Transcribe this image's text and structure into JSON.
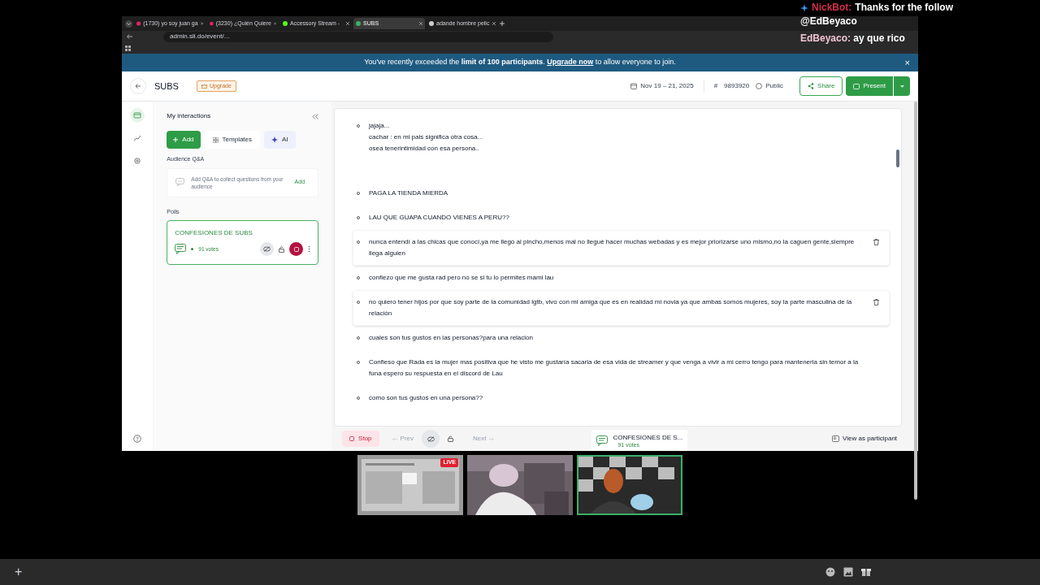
{
  "chat_overlay": {
    "lines": [
      {
        "kind": "partial",
        "user": "NickBot:",
        "text": "Thanks for the follow"
      },
      {
        "kind": "plain",
        "text": "@EdBeyaco"
      },
      {
        "kind": "message",
        "user": "EdBeyaco:",
        "text": " ay que rico"
      }
    ]
  },
  "browser": {
    "tabs": [
      {
        "label": "(1730) yo soy juan ga",
        "selected": false
      },
      {
        "label": "(3230) ¿Quién Quiere",
        "selected": false
      },
      {
        "label": "Accessory Stream -",
        "selected": false
      },
      {
        "label": "SUBS",
        "selected": true
      },
      {
        "label": "adande hombre pelic",
        "selected": false
      }
    ],
    "url": "admin.sli.do/event/..."
  },
  "banner": {
    "text": "You've recently exceeded the **limit of 100 participants**.",
    "link": "Upgrade now",
    "rest": " to allow everyone to join.",
    "close": "×"
  },
  "header": {
    "title": "SUBS",
    "upgrade": "Upgrade",
    "dates": "Nov 19 – 21, 2025",
    "code_symbol": "#",
    "code": "9893920",
    "privacy": "Public",
    "share": "Share",
    "present": "Present"
  },
  "rail": [
    {
      "selected": true
    },
    {
      "selected": false
    },
    {
      "selected": false
    }
  ],
  "panel": {
    "title": "My interactions",
    "buttons": [
      {
        "kind": "add",
        "label": "Add"
      },
      {
        "kind": "templates",
        "label": "Templates"
      },
      {
        "kind": "ai",
        "label": "AI"
      }
    ],
    "qa_heading": "Audience Q&A",
    "qa_text": "Add Q&A to collect questions from your audience",
    "qa_add": "Add",
    "polls_heading": "Polls",
    "poll": {
      "title": "CONFESIONES DE SUBS",
      "votes": "91 votes",
      "selected": true
    }
  },
  "responses": [
    {
      "lines": [
        "jajaja...",
        "cachar : en mi pais significa otra cosa...",
        "osea tenerintimidad con esa persona.."
      ],
      "hovered": false
    },
    {
      "lines": [
        "PAGA LA TIENDA MIERDA"
      ],
      "hovered": false
    },
    {
      "lines": [
        "LAU QUE GUAPA CUANDO VIENES A PERU??"
      ],
      "hovered": false
    },
    {
      "lines": [
        "nunca entendí a las chicas que conocí,ya me llegó al pincho,menos mal no llegué hacer muchas webadas y es mejor priorizarse uno mismo,no la caguen gente,siempre llega alguien"
      ],
      "hovered": true
    },
    {
      "lines": [
        "confiezo que me gusta rad pero no se si tu lo permites mami lau"
      ],
      "hovered": false
    },
    {
      "lines": [
        "no quiero tener hijos por que soy parte de la comunidad lgtb, vivo con mi amiga que es en realidad mi novia ya que ambas somos mujeres, soy la parte masculina de la relación"
      ],
      "hovered": true
    },
    {
      "lines": [
        "cuales son tus gustos en las personas?para una relacion"
      ],
      "hovered": false
    },
    {
      "lines": [
        "Confieso que Rada es la mujer mas positiva que he visto me gustaría sacarla de esa vida de streamer y que venga a vivir a mi cerro tengo para mantenerla sin temor a la funa espero su respuesta en el discord de Lau"
      ],
      "hovered": false
    },
    {
      "lines": [
        "como son tus gustos en una persona??"
      ],
      "hovered": false
    }
  ],
  "footer": {
    "stop": "Stop",
    "prev": "Prev",
    "next": "Next",
    "poll_title": "CONFESIONES DE S...",
    "votes": "91 votes",
    "view": "View as participant"
  },
  "cams": [
    {
      "live": "LIVE",
      "selected": false
    },
    {
      "selected": false
    },
    {
      "selected": true
    }
  ],
  "taskbar": {
    "plus": "+"
  }
}
